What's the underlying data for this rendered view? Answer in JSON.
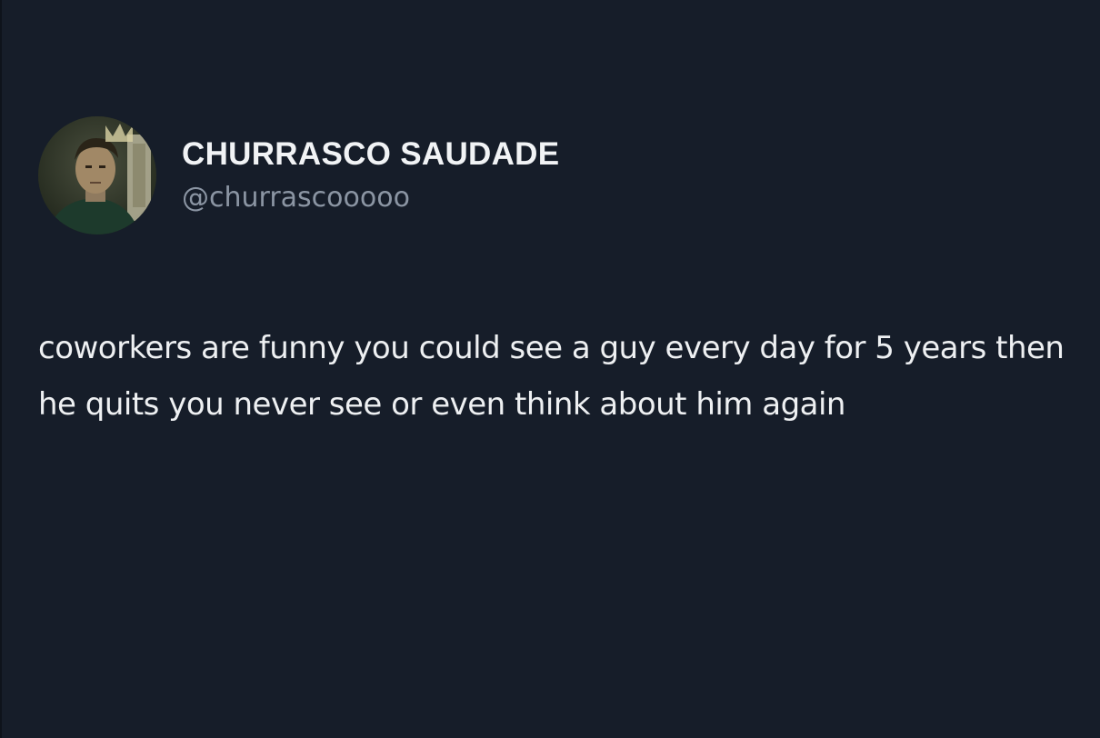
{
  "tweet": {
    "author": {
      "display_name": "CHURRASCO SAUDADE",
      "handle": "@churrascooooo",
      "avatar_icon": "profile-photo-avatar"
    },
    "text": "coworkers are funny you could see a guy every day for 5 years then he quits you never see or even think about him again"
  },
  "colors": {
    "background": "#161d29",
    "text": "#eef0f2",
    "handle": "#8b95a3"
  }
}
